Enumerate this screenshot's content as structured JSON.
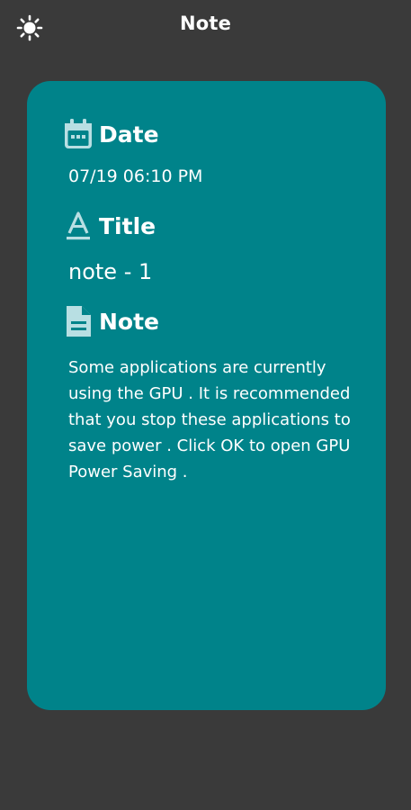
{
  "header": {
    "title": "Note",
    "theme_icon": "sun-icon"
  },
  "note": {
    "date_label": "Date",
    "date_icon": "calendar-icon",
    "date_value": "07/19 06:10 PM",
    "title_label": "Title",
    "title_icon": "text-format-icon",
    "title_value": "note - 1",
    "note_label": "Note",
    "note_icon": "document-icon",
    "note_value": "Some applications are currently using the GPU . It is recommended that you stop these applications to save power . Click OK to open GPU Power Saving ."
  },
  "colors": {
    "background": "#3a3a3a",
    "card": "#00838a",
    "icon_tint": "#b8dfe3",
    "text": "#ffffff"
  }
}
